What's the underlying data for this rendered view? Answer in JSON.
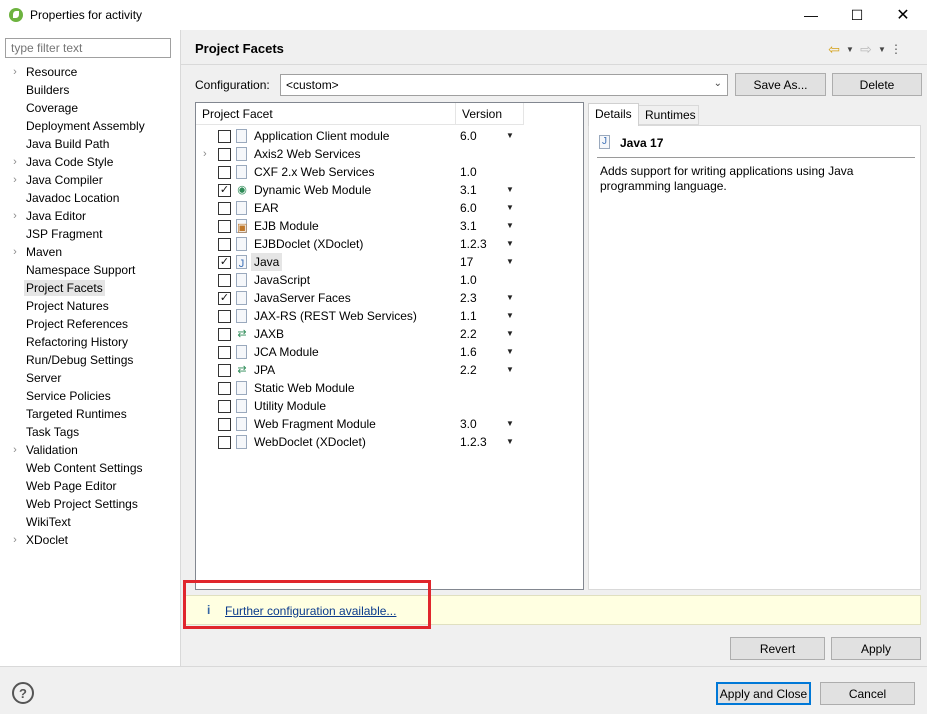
{
  "window": {
    "title": "Properties for activity"
  },
  "left_pane": {
    "filter_placeholder": "type filter text",
    "items": [
      {
        "label": "Resource",
        "expandable": true
      },
      {
        "label": "Builders",
        "expandable": false
      },
      {
        "label": "Coverage",
        "expandable": false
      },
      {
        "label": "Deployment Assembly",
        "expandable": false
      },
      {
        "label": "Java Build Path",
        "expandable": false
      },
      {
        "label": "Java Code Style",
        "expandable": true
      },
      {
        "label": "Java Compiler",
        "expandable": true
      },
      {
        "label": "Javadoc Location",
        "expandable": false
      },
      {
        "label": "Java Editor",
        "expandable": true
      },
      {
        "label": "JSP Fragment",
        "expandable": false
      },
      {
        "label": "Maven",
        "expandable": true
      },
      {
        "label": "Namespace Support",
        "expandable": false
      },
      {
        "label": "Project Facets",
        "expandable": false,
        "selected": true
      },
      {
        "label": "Project Natures",
        "expandable": false
      },
      {
        "label": "Project References",
        "expandable": false
      },
      {
        "label": "Refactoring History",
        "expandable": false
      },
      {
        "label": "Run/Debug Settings",
        "expandable": false
      },
      {
        "label": "Server",
        "expandable": false
      },
      {
        "label": "Service Policies",
        "expandable": false
      },
      {
        "label": "Targeted Runtimes",
        "expandable": false
      },
      {
        "label": "Task Tags",
        "expandable": false
      },
      {
        "label": "Validation",
        "expandable": true
      },
      {
        "label": "Web Content Settings",
        "expandable": false
      },
      {
        "label": "Web Page Editor",
        "expandable": false
      },
      {
        "label": "Web Project Settings",
        "expandable": false
      },
      {
        "label": "WikiText",
        "expandable": false
      },
      {
        "label": "XDoclet",
        "expandable": true
      }
    ]
  },
  "main": {
    "title": "Project Facets",
    "configuration": {
      "label": "Configuration:",
      "value": "<custom>",
      "save_as_label": "Save As...",
      "delete_label": "Delete"
    },
    "facets_table": {
      "col_facet": "Project Facet",
      "col_version": "Version",
      "rows": [
        {
          "name": "Application Client module",
          "version": "6.0",
          "checked": false,
          "has_dropdown": true,
          "icon": "doc"
        },
        {
          "name": "Axis2 Web Services",
          "version": "",
          "checked": false,
          "has_dropdown": false,
          "icon": "doc",
          "expander": true
        },
        {
          "name": "CXF 2.x Web Services",
          "version": "1.0",
          "checked": false,
          "has_dropdown": false,
          "icon": "doc"
        },
        {
          "name": "Dynamic Web Module",
          "version": "3.1",
          "checked": true,
          "has_dropdown": true,
          "icon": "globe"
        },
        {
          "name": "EAR",
          "version": "6.0",
          "checked": false,
          "has_dropdown": true,
          "icon": "doc"
        },
        {
          "name": "EJB Module",
          "version": "3.1",
          "checked": false,
          "has_dropdown": true,
          "icon": "bean"
        },
        {
          "name": "EJBDoclet (XDoclet)",
          "version": "1.2.3",
          "checked": false,
          "has_dropdown": true,
          "icon": "doc"
        },
        {
          "name": "Java",
          "version": "17",
          "checked": true,
          "has_dropdown": true,
          "icon": "java",
          "selected": true
        },
        {
          "name": "JavaScript",
          "version": "1.0",
          "checked": false,
          "has_dropdown": false,
          "icon": "doc"
        },
        {
          "name": "JavaServer Faces",
          "version": "2.3",
          "checked": true,
          "has_dropdown": true,
          "icon": "doc"
        },
        {
          "name": "JAX-RS (REST Web Services)",
          "version": "1.1",
          "checked": false,
          "has_dropdown": true,
          "icon": "doc"
        },
        {
          "name": "JAXB",
          "version": "2.2",
          "checked": false,
          "has_dropdown": true,
          "icon": "arrows"
        },
        {
          "name": "JCA Module",
          "version": "1.6",
          "checked": false,
          "has_dropdown": true,
          "icon": "doc"
        },
        {
          "name": "JPA",
          "version": "2.2",
          "checked": false,
          "has_dropdown": true,
          "icon": "arrows"
        },
        {
          "name": "Static Web Module",
          "version": "",
          "checked": false,
          "has_dropdown": false,
          "icon": "doc"
        },
        {
          "name": "Utility Module",
          "version": "",
          "checked": false,
          "has_dropdown": false,
          "icon": "doc"
        },
        {
          "name": "Web Fragment Module",
          "version": "3.0",
          "checked": false,
          "has_dropdown": true,
          "icon": "doc"
        },
        {
          "name": "WebDoclet (XDoclet)",
          "version": "1.2.3",
          "checked": false,
          "has_dropdown": true,
          "icon": "doc"
        }
      ]
    },
    "details": {
      "tab_details": "Details",
      "tab_runtimes": "Runtimes",
      "title": "Java 17",
      "description": "Adds support for writing applications using Java programming language."
    },
    "info_bar": {
      "icon": "i",
      "link_text": "Further configuration available..."
    },
    "revert_label": "Revert",
    "apply_label": "Apply"
  },
  "footer": {
    "help_icon": "?",
    "apply_close_label": "Apply and Close",
    "cancel_label": "Cancel"
  },
  "colors": {
    "highlight_border": "#e0262d",
    "info_background": "#ffffe1",
    "link": "#0b3b8c"
  }
}
